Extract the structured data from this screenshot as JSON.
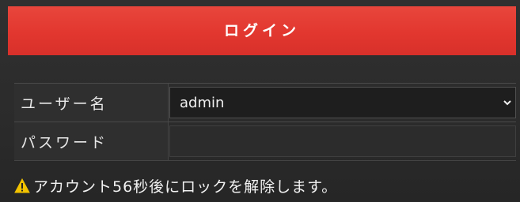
{
  "dialog": {
    "title": "ログイン",
    "accent_color": "#e2372f"
  },
  "form": {
    "username": {
      "label": "ユーザー名",
      "value": "admin",
      "icon": "chevron-down-icon"
    },
    "password": {
      "label": "パスワード",
      "value": ""
    }
  },
  "warning": {
    "icon": "warning-triangle-icon",
    "icon_color": "#f2c300",
    "text": "アカウント56秒後にロックを解除します。"
  }
}
